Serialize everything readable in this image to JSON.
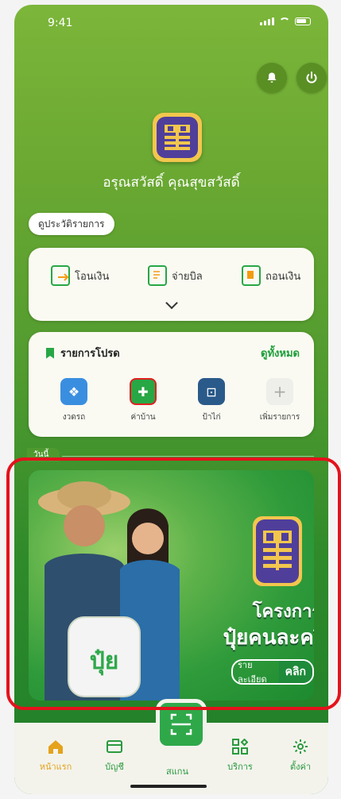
{
  "status": {
    "time": "9:41"
  },
  "header": {
    "greeting": "อรุณสวัสดิ์ คุณสุขสวัสดิ์",
    "bell_icon": "bell-icon",
    "power_icon": "power-icon"
  },
  "history_button": "ดูประวัติรายการ",
  "quick_actions": {
    "transfer": "โอนเงิน",
    "paybill": "จ่ายบิล",
    "withdraw": "ถอนเงิน"
  },
  "favorites": {
    "title": "รายการโปรด",
    "see_all": "ดูทั้งหมด",
    "items": [
      {
        "label": "งวดรถ"
      },
      {
        "label": "ค่าบ้าน"
      },
      {
        "label": "ป้าไก่"
      },
      {
        "label": "เพิ่มรายการ"
      }
    ]
  },
  "today_label": "วันนี้",
  "banner": {
    "line1": "โครงการ",
    "line2": "ปุ๋ยคนละครึ่ง",
    "detail": "รายละเอียด",
    "click": "คลิก",
    "sack_text": "ปุ๋ย"
  },
  "nav": {
    "home": "หน้าแรก",
    "account": "บัญชี",
    "scan": "สแกน",
    "services": "บริการ",
    "settings": "ตั้งค่า"
  },
  "colors": {
    "accent": "#2fa84a",
    "brand_gold": "#f2c64d",
    "brand_purple": "#4f3f9a",
    "highlight": "#e5121c"
  }
}
